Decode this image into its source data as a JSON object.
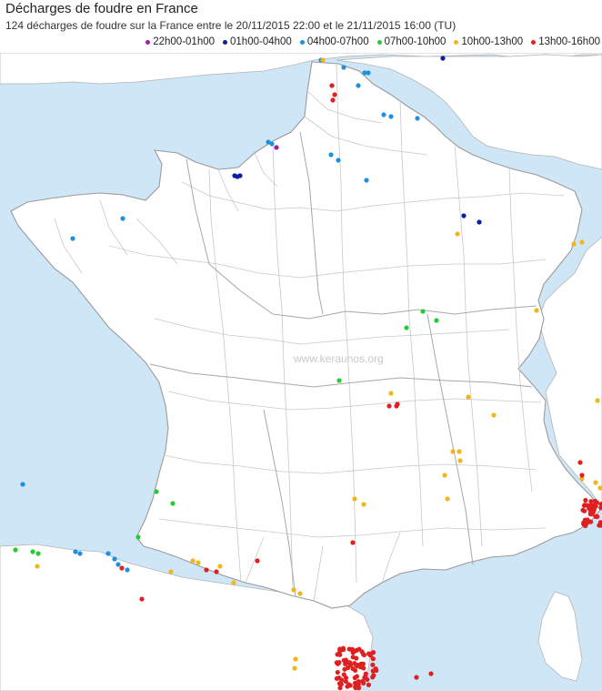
{
  "header": {
    "title": "Décharges de foudre en France",
    "subtitle": "124 décharges de foudre sur la France entre le 20/11/2015 22:00 et le 21/11/2015 16:00 (TU)"
  },
  "legend": [
    {
      "label": "22h00-01h00",
      "color": "#a020a0"
    },
    {
      "label": "01h00-04h00",
      "color": "#0a1ea0"
    },
    {
      "label": "04h00-07h00",
      "color": "#1e90e0"
    },
    {
      "label": "07h00-10h00",
      "color": "#22cc33"
    },
    {
      "label": "10h00-13h00",
      "color": "#f2b51c"
    },
    {
      "label": "13h00-16h00",
      "color": "#e02020"
    }
  ],
  "watermark": "www.keraunos.org",
  "colors": {
    "sea": "#cfe6f7",
    "land": "#ffffff",
    "border": "#b4b4b4"
  }
}
